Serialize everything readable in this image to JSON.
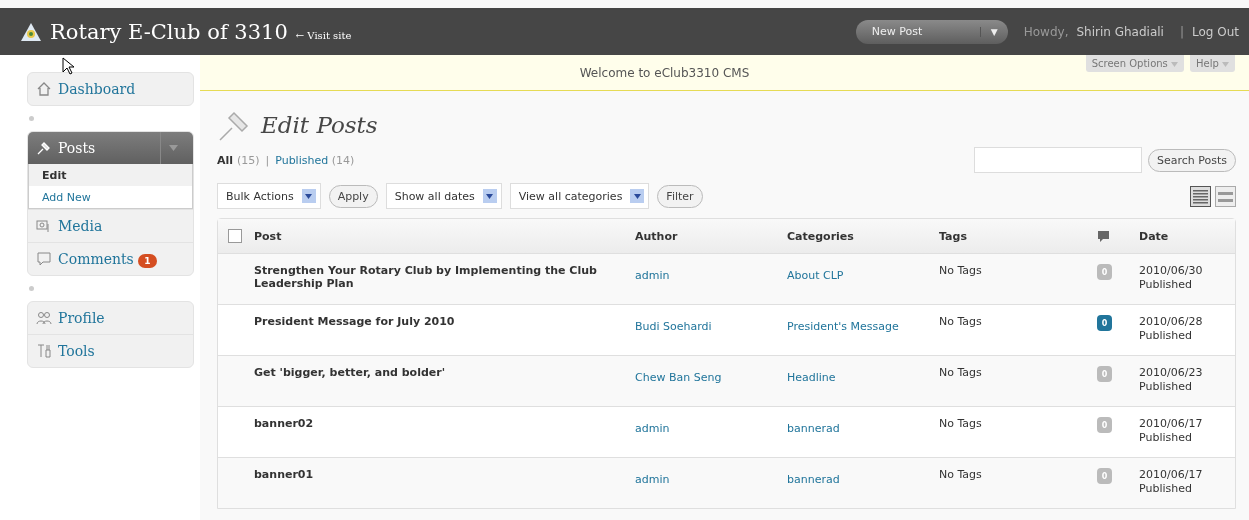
{
  "header": {
    "site_title": "Rotary E-Club of 3310",
    "visit_link": "← Visit site",
    "new_post_button": "New Post",
    "dropdown_glyph": "▼",
    "greeting": "Howdy, ",
    "user_name": "Shirin Ghadiali",
    "separator": "|",
    "logout": "Log Out"
  },
  "notice": {
    "text": "Welcome to eClub3310 CMS",
    "screen_options": "Screen Options",
    "help": "Help"
  },
  "sidebar": {
    "groups": [
      [
        {
          "label": "Dashboard",
          "selected": false
        }
      ],
      [
        {
          "label": "Posts",
          "selected": true,
          "expanded": true,
          "children": [
            {
              "label": "Edit",
              "selected": true
            },
            {
              "label": "Add New",
              "selected": false
            }
          ]
        },
        {
          "label": "Media",
          "selected": false
        },
        {
          "label": "Comments",
          "selected": false,
          "badge": "1"
        }
      ],
      [
        {
          "label": "Profile",
          "selected": false
        },
        {
          "label": "Tools",
          "selected": false
        }
      ]
    ]
  },
  "page": {
    "title": "Edit Posts",
    "filters": [
      {
        "label": "All",
        "count": "(15)",
        "selected": true
      },
      {
        "label": "Published",
        "count": "(14)",
        "selected": false
      }
    ],
    "filter_separator": "|",
    "search_button": "Search Posts",
    "selects": [
      {
        "value": "Bulk Actions"
      },
      {
        "value": "Apply",
        "kind": "button"
      },
      {
        "value": "Show all dates"
      },
      {
        "value": "View all categories"
      },
      {
        "value": "Filter",
        "kind": "button"
      }
    ],
    "view_modes": [
      {
        "selected": true
      },
      {
        "selected": false
      }
    ]
  },
  "table": {
    "select_all": {
      "checked": false
    },
    "columns": [
      {
        "label": "Post"
      },
      {
        "label": "Author"
      },
      {
        "label": "Categories"
      },
      {
        "label": "Tags"
      },
      {
        "kind": "comments"
      },
      {
        "label": "Date"
      }
    ],
    "rows": [
      {
        "title": "Strengthen Your Rotary Club by Implementing the Club Leadership Plan",
        "author": "admin",
        "category": "About CLP",
        "tags": "No Tags",
        "comments": "0",
        "pending": false,
        "date": "2010/06/30",
        "status": "Published"
      },
      {
        "title": "President Message for July 2010",
        "author": "Budi Soehardi",
        "category": "President's Message",
        "tags": "No Tags",
        "comments": "0",
        "pending": true,
        "date": "2010/06/28",
        "status": "Published"
      },
      {
        "title": "Get 'bigger, better, and bolder'",
        "author": "Chew Ban Seng",
        "category": "Headline",
        "tags": "No Tags",
        "comments": "0",
        "pending": false,
        "date": "2010/06/23",
        "status": "Published"
      },
      {
        "title": "banner02",
        "author": "admin",
        "category": "bannerad",
        "tags": "No Tags",
        "comments": "0",
        "pending": false,
        "date": "2010/06/17",
        "status": "Published"
      },
      {
        "title": "banner01",
        "author": "admin",
        "category": "bannerad",
        "tags": "No Tags",
        "comments": "0",
        "pending": false,
        "date": "2010/06/17",
        "status": "Published"
      }
    ]
  }
}
